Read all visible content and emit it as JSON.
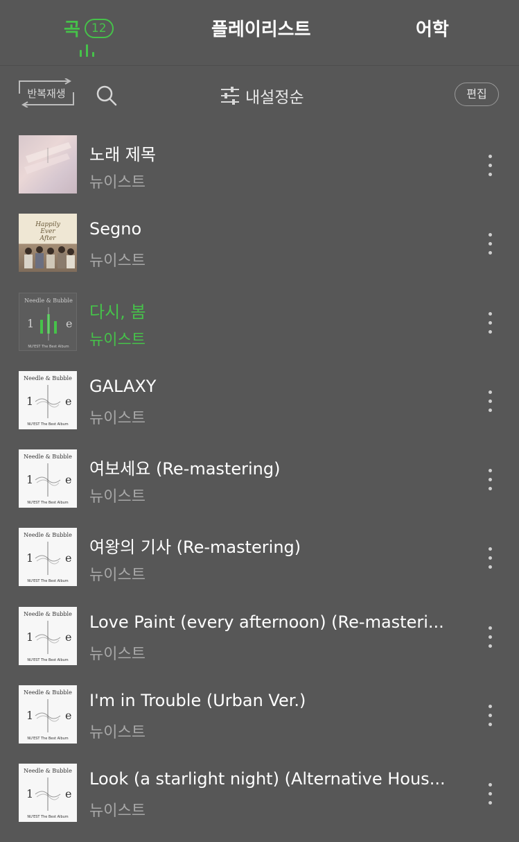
{
  "tabs": {
    "songs_label": "곡",
    "songs_count": "12",
    "playlist_label": "플레이리스트",
    "language_label": "어학"
  },
  "toolbar": {
    "repeat_label": "반복재생",
    "sort_label": "내설정순",
    "edit_label": "편집"
  },
  "colors": {
    "accent": "#46c24a",
    "background": "#575757"
  },
  "songs": [
    {
      "title": "노래 제목",
      "artist": "뉴이스트",
      "cover": "pink"
    },
    {
      "title": "Segno",
      "artist": "뉴이스트",
      "cover": "group",
      "cover_text": "Happily Ever After"
    },
    {
      "title": "다시, 봄",
      "artist": "뉴이스트",
      "cover": "dark",
      "playing": true,
      "cover_text": "Needle & Bubble"
    },
    {
      "title": "GALAXY",
      "artist": "뉴이스트",
      "cover": "white",
      "cover_text": "Needle & Bubble"
    },
    {
      "title": "여보세요 (Re-mastering)",
      "artist": "뉴이스트",
      "cover": "white",
      "cover_text": "Needle & Bubble"
    },
    {
      "title": "여왕의 기사 (Re-mastering)",
      "artist": "뉴이스트",
      "cover": "white",
      "cover_text": "Needle & Bubble"
    },
    {
      "title": "Love Paint (every afternoon)  (Re-masteri...",
      "artist": "뉴이스트",
      "cover": "white",
      "cover_text": "Needle & Bubble"
    },
    {
      "title": "I'm in Trouble (Urban Ver.)",
      "artist": "뉴이스트",
      "cover": "white",
      "cover_text": "Needle & Bubble"
    },
    {
      "title": "Look (a starlight night) (Alternative Hous...",
      "artist": "뉴이스트",
      "cover": "white",
      "cover_text": "Needle & Bubble"
    }
  ]
}
